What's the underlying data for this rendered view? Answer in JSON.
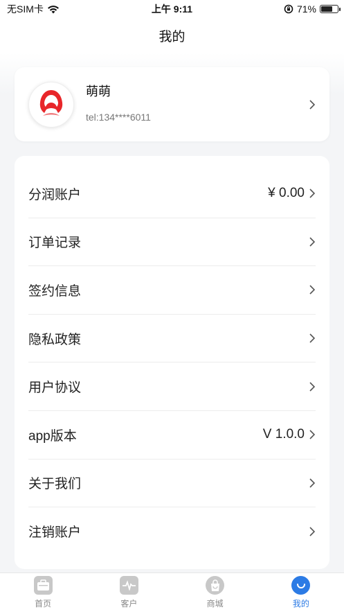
{
  "status_bar": {
    "carrier": "无SIM卡",
    "time": "上午 9:11",
    "battery_percent": "71%",
    "battery_level": 0.71
  },
  "header": {
    "title": "我的"
  },
  "profile": {
    "name": "萌萌",
    "phone": "tel:134****6011"
  },
  "menu": {
    "items": [
      {
        "label": "分润账户",
        "value": "¥ 0.00"
      },
      {
        "label": "订单记录",
        "value": ""
      },
      {
        "label": "签约信息",
        "value": ""
      },
      {
        "label": "隐私政策",
        "value": ""
      },
      {
        "label": "用户协议",
        "value": ""
      },
      {
        "label": "app版本",
        "value": "V 1.0.0"
      },
      {
        "label": "关于我们",
        "value": ""
      },
      {
        "label": "注销账户",
        "value": ""
      }
    ]
  },
  "tabs": [
    {
      "label": "首页",
      "icon": "home-bag-icon",
      "active": false
    },
    {
      "label": "客户",
      "icon": "pulse-icon",
      "active": false
    },
    {
      "label": "商城",
      "icon": "shopping-bag-icon",
      "active": false
    },
    {
      "label": "我的",
      "icon": "smile-icon",
      "active": true
    }
  ],
  "colors": {
    "accent": "#2c7be5",
    "logo_red": "#e8262a",
    "inactive_tab": "#c8c8c8"
  }
}
